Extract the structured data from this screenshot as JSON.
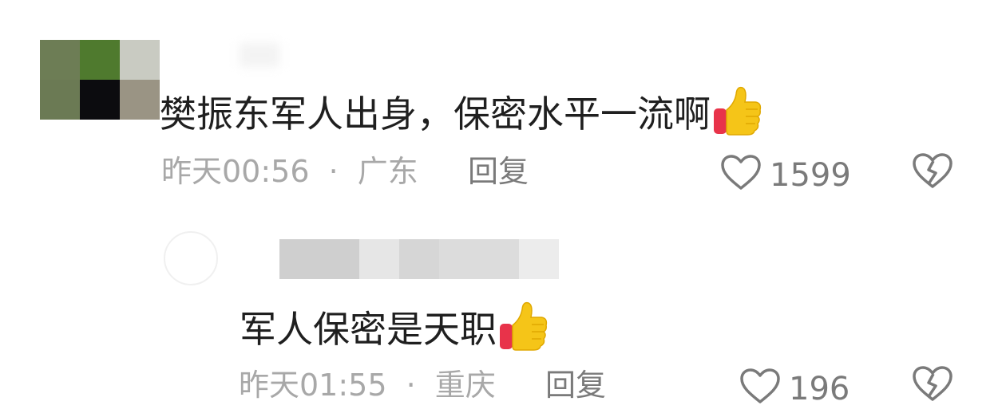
{
  "comment": {
    "text": "樊振东军人出身，保密水平一流啊",
    "time": "昨天00:56",
    "separator": "·",
    "location": "广东",
    "reply_label": "回复",
    "likes": "1599",
    "emoji": "thumbs-up-icon"
  },
  "reply": {
    "text": "军人保密是天职",
    "time": "昨天01:55",
    "separator": "·",
    "location": "重庆",
    "reply_label": "回复",
    "likes": "196",
    "emoji": "thumbs-up-icon"
  },
  "colors": {
    "text": "#1f1f1f",
    "meta": "#a8a8a8",
    "action": "#7a7a7a",
    "thumb": "#f5c518",
    "thumb_cuff": "#e8334a"
  }
}
